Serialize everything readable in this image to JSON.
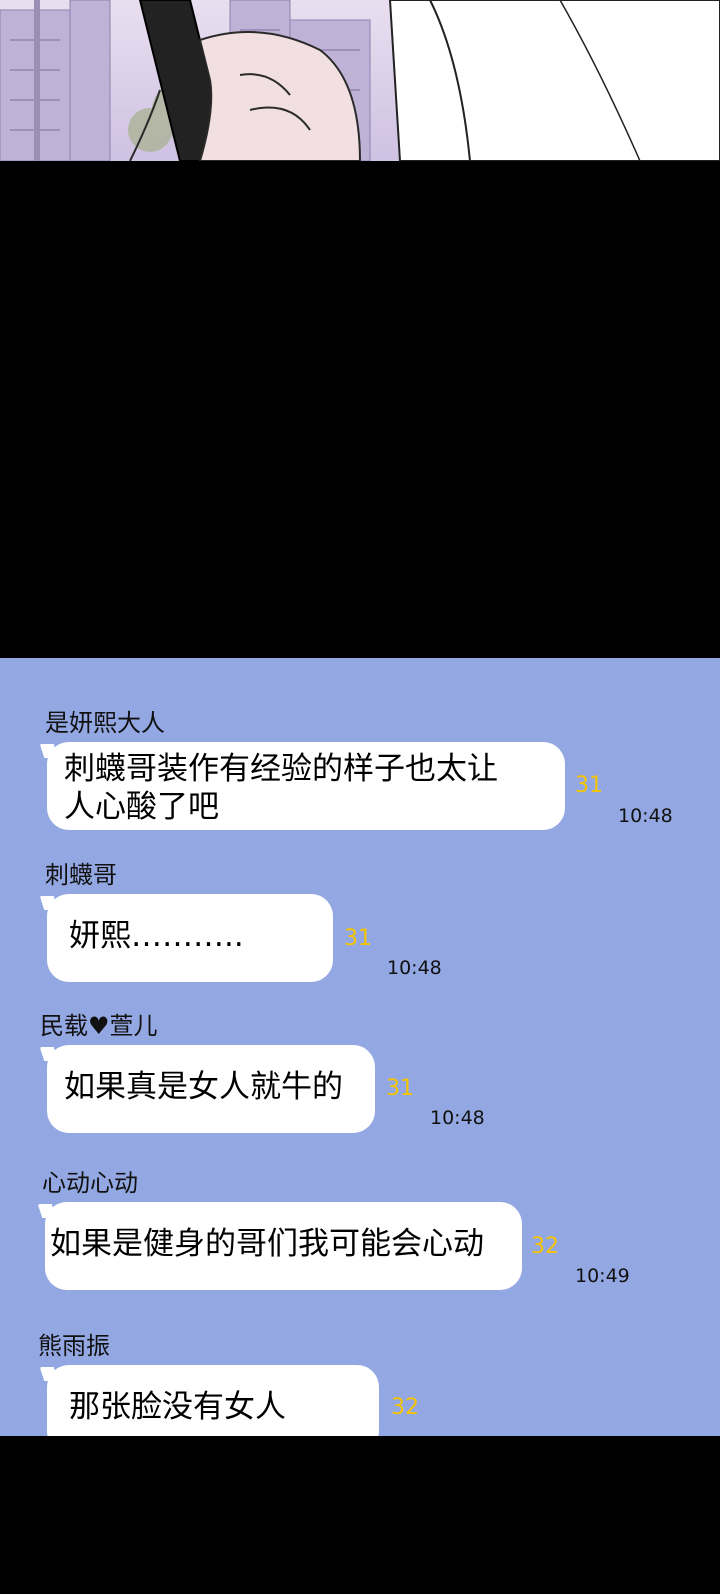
{
  "messages": [
    {
      "sender": "是妍熙大人",
      "text": "刺蠛哥装作有经验的样子也太让人心酸了吧",
      "count": "31",
      "time": "10:48"
    },
    {
      "sender": "刺蠛哥",
      "text": "妍熙………..",
      "count": "31",
      "time": "10:48"
    },
    {
      "sender": "民载♥萱儿",
      "text": "如果真是女人就牛的",
      "count": "31",
      "time": "10:48"
    },
    {
      "sender": "心动心动",
      "text": "如果是健身的哥们我可能会心动",
      "count": "32",
      "time": "10:49"
    },
    {
      "sender": "熊雨振",
      "text": "那张脸没有女人",
      "count": "32",
      "time": ""
    }
  ]
}
